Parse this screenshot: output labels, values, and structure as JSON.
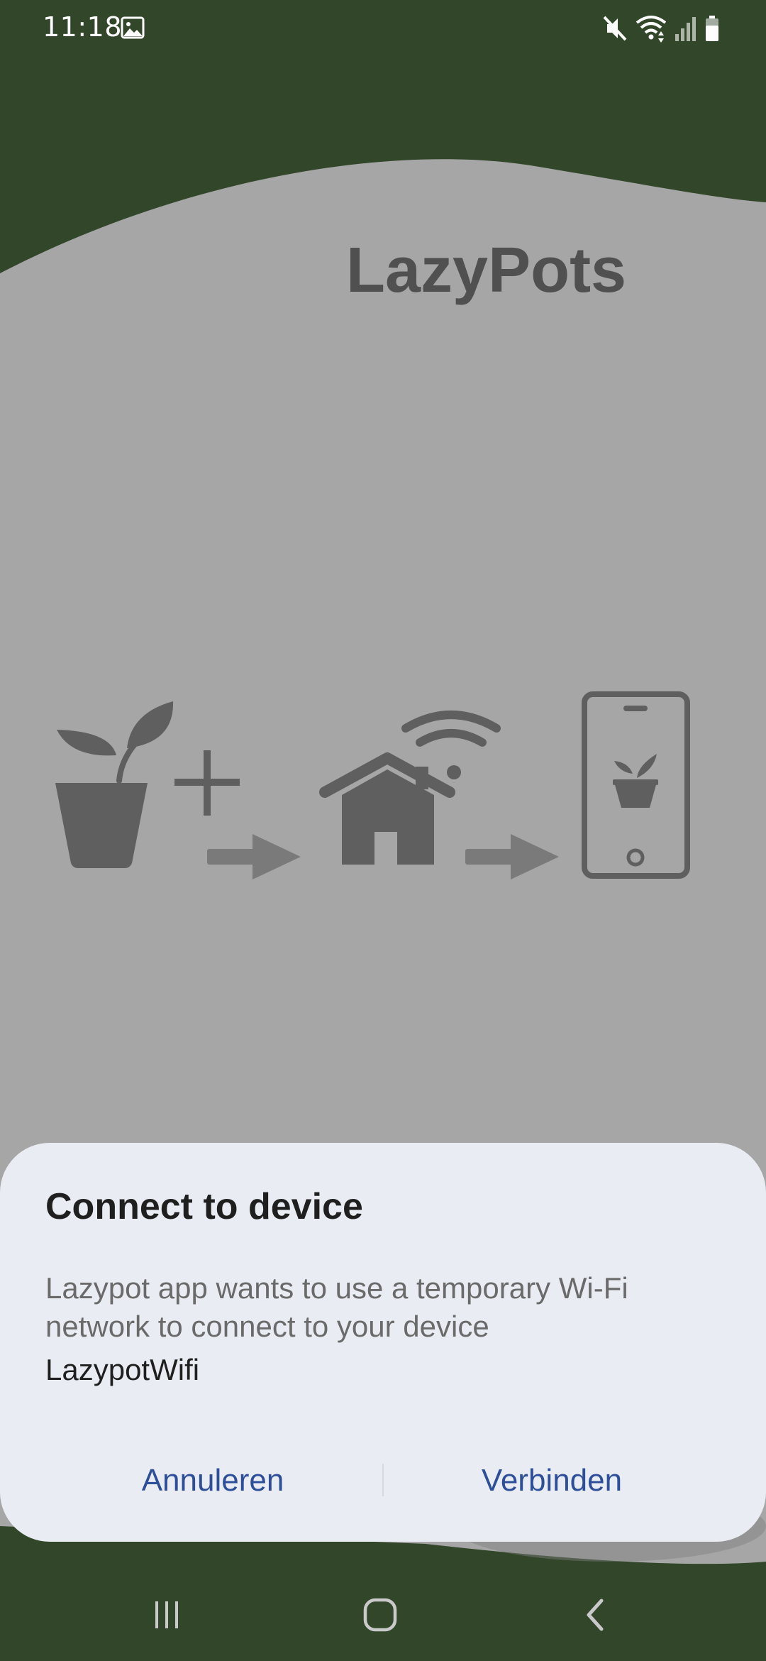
{
  "status_bar": {
    "time": "11:18",
    "left_icons": [
      "gallery-icon"
    ],
    "right_icons": [
      "mute-icon",
      "wifi-icon",
      "signal-icon",
      "battery-icon"
    ]
  },
  "app": {
    "title": "LazyPots",
    "illustration_icons": [
      "plant-pot-icon",
      "plus-icon",
      "arrow-right-icon",
      "home-wifi-icon",
      "arrow-right-icon",
      "phone-plant-icon"
    ]
  },
  "dialog": {
    "title": "Connect to device",
    "message": "Lazypot app wants to use a temporary Wi-Fi network to connect to your device",
    "network_name": "LazypotWifi",
    "cancel_label": "Annuleren",
    "connect_label": "Verbinden"
  },
  "nav_bar": {
    "icons": [
      "recents-icon",
      "home-icon",
      "back-icon"
    ]
  },
  "colors": {
    "frame_green": "#32462a",
    "content_gray": "#a6a6a6",
    "title_gray": "#505050",
    "illustration_gray": "#5f5f5f",
    "dialog_bg": "#e9edf3",
    "dialog_button": "#2d4f9a"
  }
}
